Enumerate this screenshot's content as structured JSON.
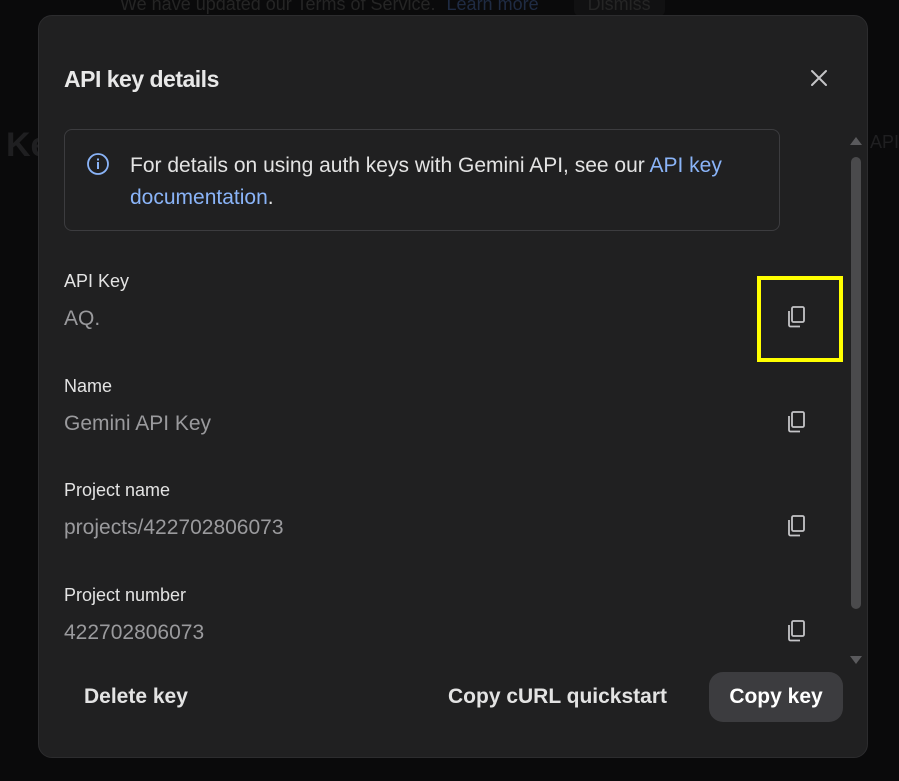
{
  "background": {
    "banner_text": "We have updated our Terms of Service.",
    "banner_link": "Learn more",
    "banner_dismiss": "Dismiss",
    "title_fragment": "Ke",
    "right_fragment": "API"
  },
  "dialog": {
    "title": "API key details",
    "info": {
      "text": "For details on using auth keys with Gemini API, see our",
      "link": "API key documentation",
      "suffix": "."
    },
    "fields": [
      {
        "label": "API Key",
        "value": "AQ."
      },
      {
        "label": "Name",
        "value": "Gemini API Key"
      },
      {
        "label": "Project name",
        "value": "projects/422702806073"
      },
      {
        "label": "Project number",
        "value": "422702806073"
      }
    ],
    "footer": {
      "delete_label": "Delete key",
      "curl_label": "Copy cURL quickstart",
      "copy_label": "Copy key"
    }
  },
  "colors": {
    "accent_link": "#8ab4f8",
    "highlight": "#ffff00",
    "dialog_bg": "#202021"
  },
  "icons": {
    "close": "close-icon",
    "info": "info-icon",
    "copy": "copy-icon"
  }
}
